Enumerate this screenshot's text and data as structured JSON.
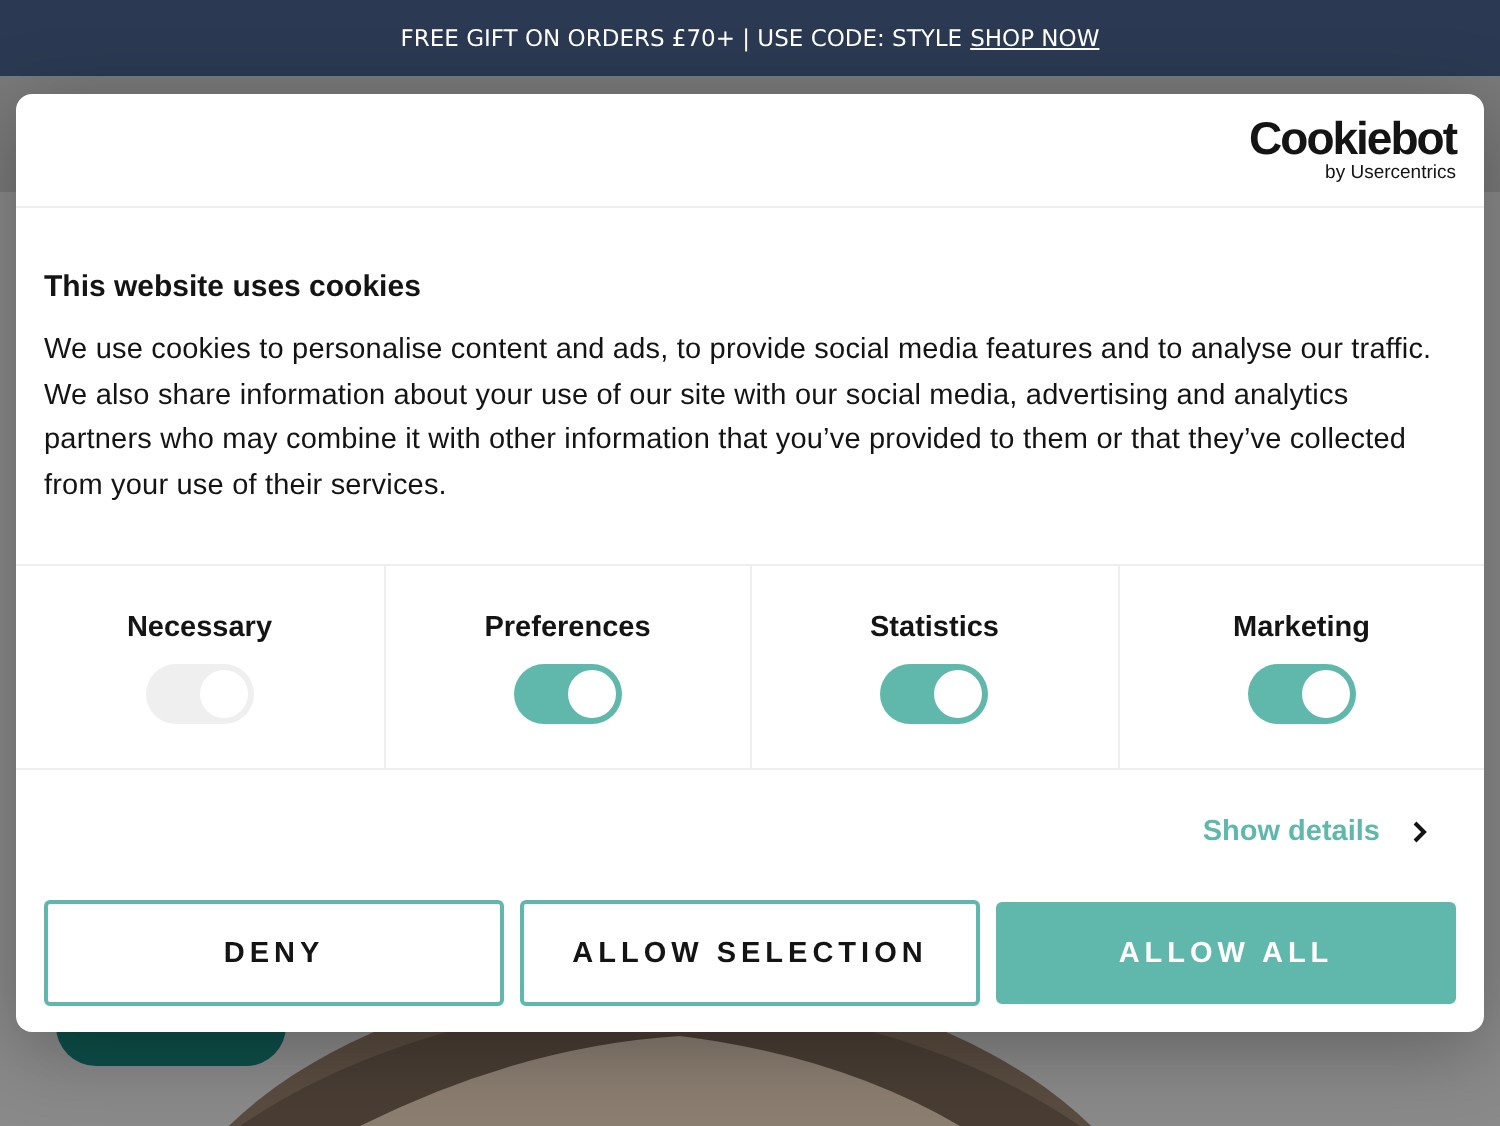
{
  "banner": {
    "text": "FREE GIFT ON ORDERS £70+ | USE CODE: STYLE",
    "link": "SHOP NOW"
  },
  "dialog": {
    "logo": {
      "name": "Cookiebot",
      "byline": "by Usercentrics"
    },
    "title": "This website uses cookies",
    "body": "We use cookies to personalise content and ads, to provide social media features and to analyse our traffic. We also share information about your use of our site with our social media, advertising and analytics partners who may combine it with other information that you’ve provided to them or that they’ve collected from your use of their services.",
    "categories": [
      {
        "label": "Necessary",
        "on": true,
        "disabled": true
      },
      {
        "label": "Preferences",
        "on": true,
        "disabled": false
      },
      {
        "label": "Statistics",
        "on": true,
        "disabled": false
      },
      {
        "label": "Marketing",
        "on": true,
        "disabled": false
      }
    ],
    "details_link": "Show details",
    "buttons": [
      {
        "label": "DENY",
        "kind": "outline"
      },
      {
        "label": "ALLOW SELECTION",
        "kind": "outline"
      },
      {
        "label": "ALLOW ALL",
        "kind": "filled"
      }
    ]
  }
}
